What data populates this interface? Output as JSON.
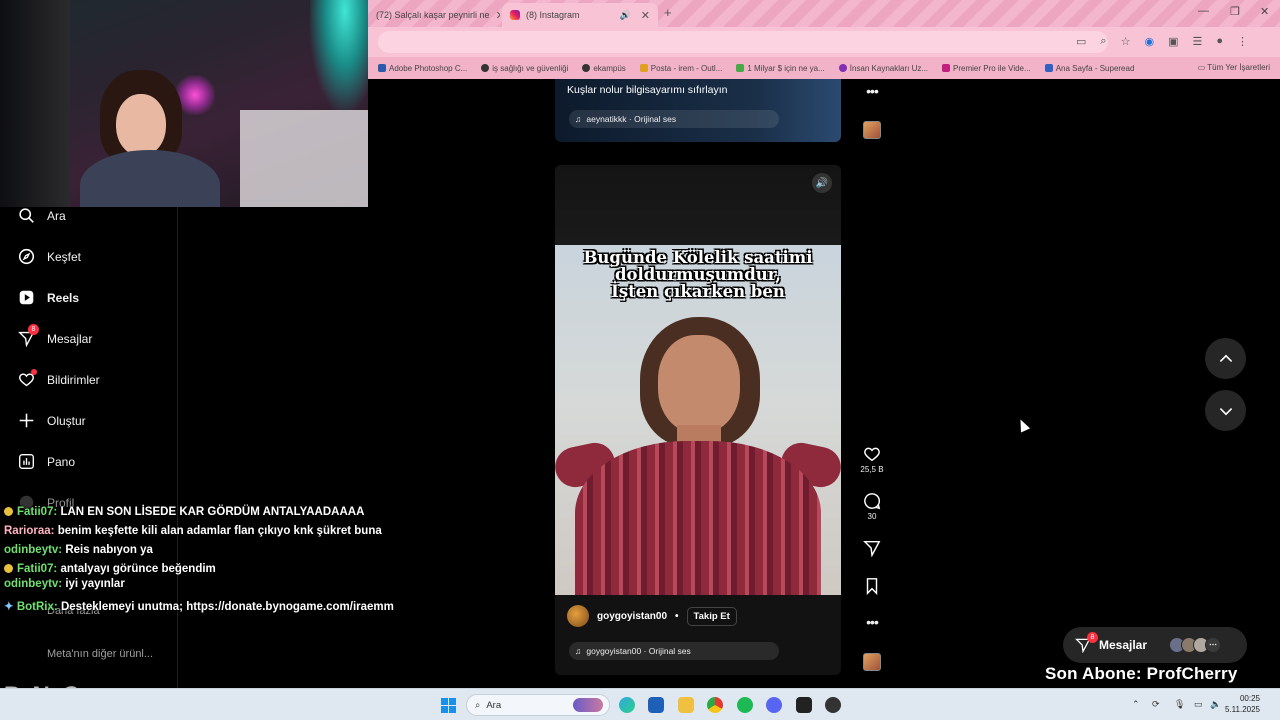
{
  "browser": {
    "tabs": [
      {
        "label": "(72) Salçalı kaşar peynirli ne"
      },
      {
        "label": "(8) Instagram"
      }
    ],
    "bookmarks": [
      "Adobe Photoshop C...",
      "iş sağlığı ve güvenliği",
      "ekampüs",
      "Posta - irem - Outl...",
      "1 Milyar $ için ne ya...",
      "İnsan Kaynakları Uz...",
      "Premier Pro ile Vide...",
      "Ana Sayfa - Superead"
    ],
    "bookmarks_all": "Tüm Yer İşaretleri"
  },
  "sidebar": {
    "items": [
      {
        "label": "Ara"
      },
      {
        "label": "Keşfet"
      },
      {
        "label": "Reels"
      },
      {
        "label": "Mesajlar",
        "badge": "8"
      },
      {
        "label": "Bildirimler"
      },
      {
        "label": "Oluştur"
      },
      {
        "label": "Pano"
      },
      {
        "label": "Profil"
      }
    ],
    "more": "Daha fazla",
    "meta": "Meta'nın diğer ürünl..."
  },
  "chat": [
    {
      "user": "Fatii07:",
      "msg": "LAN EN SON LİSEDE KAR GÖRDÜM ANTALYAADAAAA"
    },
    {
      "user": "Rarioraa:",
      "msg": "benim keşfette kili alan adamlar flan çıkıyo knk şükret buna"
    },
    {
      "user": "odinbeytv:",
      "msg": "Reis nabıyon ya"
    },
    {
      "user": "Fatii07:",
      "msg": "antalyayı görünce beğendim"
    },
    {
      "user": "odinbeytv:",
      "msg": "iyi yayınlar"
    },
    {
      "user": "BotRix:",
      "msg": "Desteklemeyi unutma; https://donate.bynogame.com/iraemm"
    }
  ],
  "brand_logo": "ByNoGame",
  "previous_reel": {
    "caption": "Kuşlar nolur bilgisayarımı sıfırlayın",
    "audio": "aeynatikkk · Orijinal ses"
  },
  "reel": {
    "overlay_text": [
      "Bugünde Kölelik saatimi",
      "doldurmuşumdur,",
      "İşten çıkarken ben"
    ],
    "author": "goygoyistan00",
    "separator": "•",
    "follow": "Takip Et",
    "audio": "goygoyistan00 · Orijinal ses",
    "likes": "25,5 B",
    "comments": "30"
  },
  "messages_pill": {
    "label": "Mesajlar",
    "badge": "8"
  },
  "overlay_subscriber": "Son Abone: ProfCherry",
  "taskbar": {
    "search": "Ara",
    "time": "00:25",
    "date": "5.11.2025"
  },
  "colors": {
    "accent_red": "#ff3040",
    "chrome_pink": "#f3b6cc"
  }
}
